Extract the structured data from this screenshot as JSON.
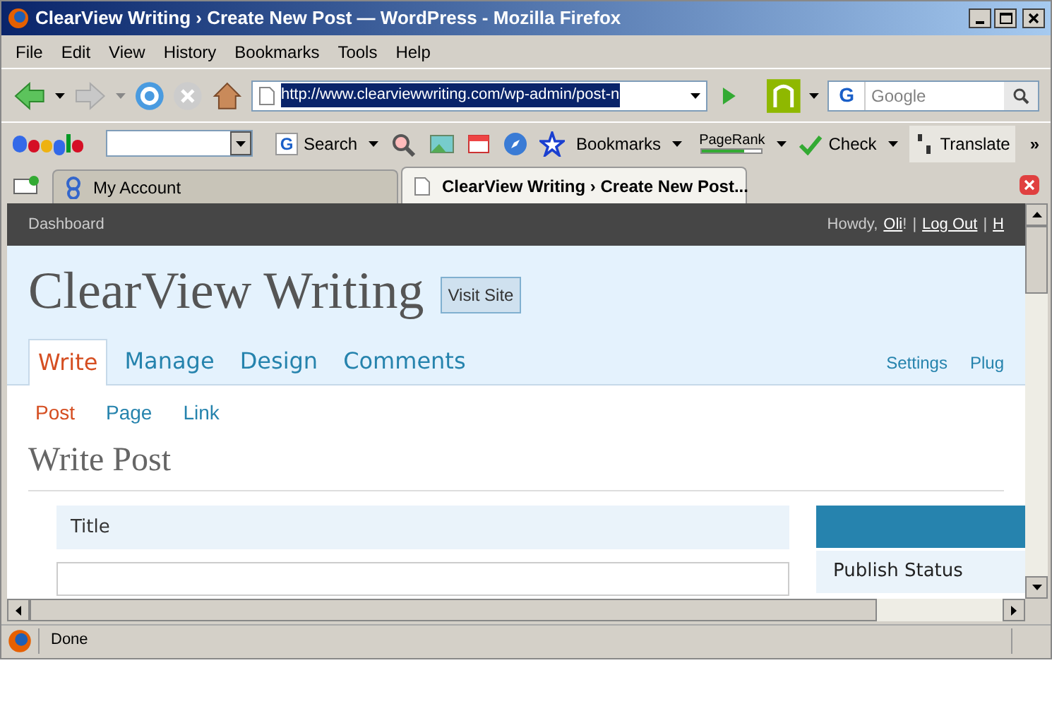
{
  "window": {
    "title": "ClearView Writing › Create New Post — WordPress - Mozilla Firefox"
  },
  "menu": [
    "File",
    "Edit",
    "View",
    "History",
    "Bookmarks",
    "Tools",
    "Help"
  ],
  "navigation": {
    "url": "http://www.clearviewwriting.com/wp-admin/post-n",
    "engine_glyph": "G",
    "search_placeholder": "Google"
  },
  "google_toolbar": {
    "search_glyph": "G",
    "search_label": "Search",
    "bookmarks_label": "Bookmarks",
    "pagerank": {
      "label": "PageRank",
      "level": 0.7
    },
    "check_label": "Check",
    "translate_label": "Translate",
    "more": "»"
  },
  "tabs": [
    {
      "label": "My Account",
      "selected": false
    },
    {
      "label": "ClearView Writing › Create New Post...",
      "selected": true
    }
  ],
  "admin_bar": {
    "dashboard": "Dashboard",
    "howdy": "Howdy,",
    "user": "Oli",
    "after_user": "!",
    "separator_1": "|",
    "logout": "Log Out",
    "separator_2": "|",
    "cut_link": "H"
  },
  "site": {
    "title": "ClearView Writing",
    "visit_button": "Visit Site"
  },
  "main_tabs": [
    {
      "label": "Write",
      "selected": true
    },
    {
      "label": "Manage",
      "selected": false
    },
    {
      "label": "Design",
      "selected": false
    },
    {
      "label": "Comments",
      "selected": false
    }
  ],
  "right_links": [
    "Settings",
    "Plug"
  ],
  "sub_tabs": [
    {
      "label": "Post",
      "selected": true
    },
    {
      "label": "Page",
      "selected": false
    },
    {
      "label": "Link",
      "selected": false
    }
  ],
  "page_heading": "Write Post",
  "title_box": {
    "label": "Title"
  },
  "sidebar": {
    "publish_status": "Publish Status"
  },
  "status_bar": {
    "text": "Done"
  }
}
